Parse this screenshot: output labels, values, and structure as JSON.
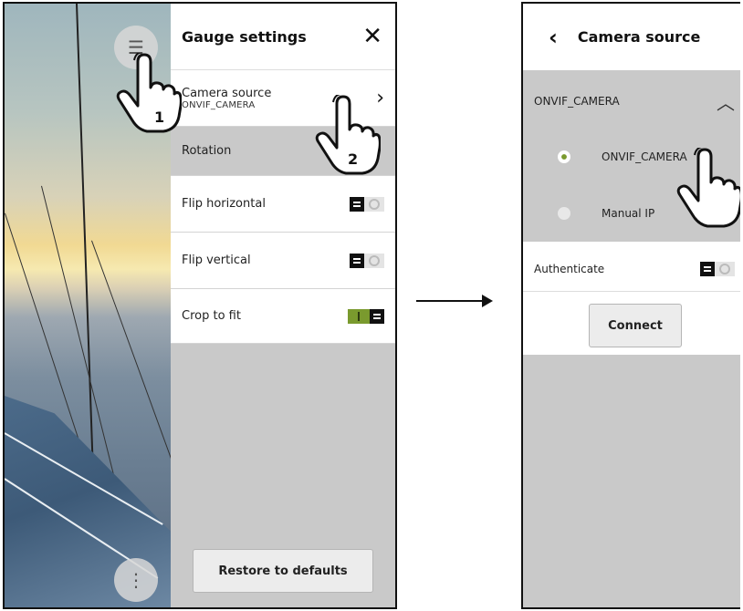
{
  "settings": {
    "title": "Gauge settings",
    "close_icon": "close-icon",
    "camera_source_label": "Camera source",
    "camera_source_value": "ONVIF_CAMERA",
    "rotation_label": "Rotation",
    "flip_horizontal_label": "Flip horizontal",
    "flip_horizontal_on": false,
    "flip_vertical_label": "Flip vertical",
    "flip_vertical_on": false,
    "crop_to_fit_label": "Crop to fit",
    "crop_to_fit_on": true,
    "restore_label": "Restore to defaults"
  },
  "camera_source": {
    "title": "Camera source",
    "section_label": "ONVIF_CAMERA",
    "options": [
      "ONVIF_CAMERA",
      "Manual IP"
    ],
    "selected": "ONVIF_CAMERA",
    "authenticate_label": "Authenticate",
    "authenticate_on": false,
    "connect_label": "Connect"
  },
  "callouts": {
    "step1": "1",
    "step2": "2"
  },
  "colors": {
    "accent": "#7a9a2e",
    "panel_grey": "#c9c9c9"
  }
}
